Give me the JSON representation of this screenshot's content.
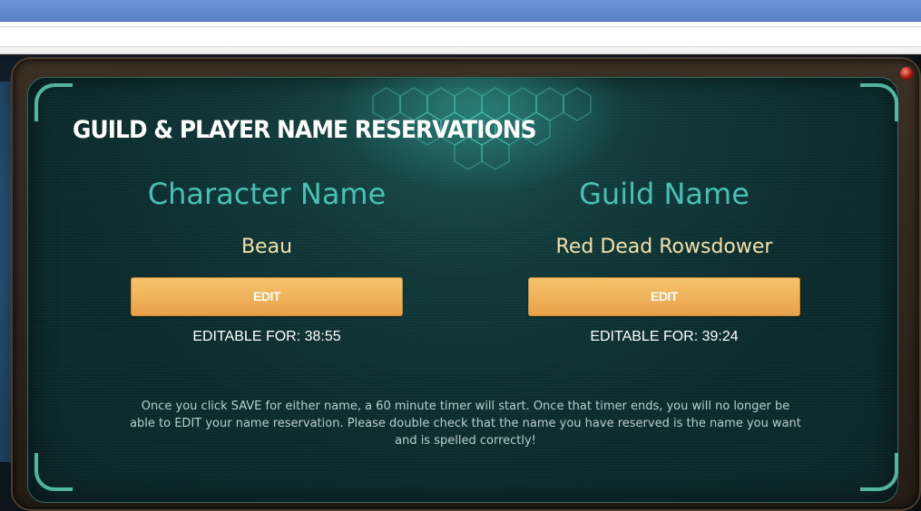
{
  "page": {
    "title": "GUILD & PLAYER NAME RESERVATIONS",
    "notice": "Once you click SAVE for either name, a 60 minute timer will start. Once that timer ends, you will no longer be able to EDIT your name reservation. Please double check that the name you have reserved is the name you want and is spelled correctly!"
  },
  "character": {
    "heading": "Character Name",
    "value": "Beau",
    "button_label": "EDIT",
    "timer": "EDITABLE FOR: 38:55"
  },
  "guild": {
    "heading": "Guild Name",
    "value": "Red Dead Rowsdower",
    "button_label": "EDIT",
    "timer": "EDITABLE FOR: 39:24"
  },
  "colors": {
    "heading": "#49c0b3",
    "value": "#f4e0a6",
    "button": "#eeb25a",
    "panel": "#0c2c2e"
  },
  "icons": {
    "status_light": "red-led-icon"
  }
}
